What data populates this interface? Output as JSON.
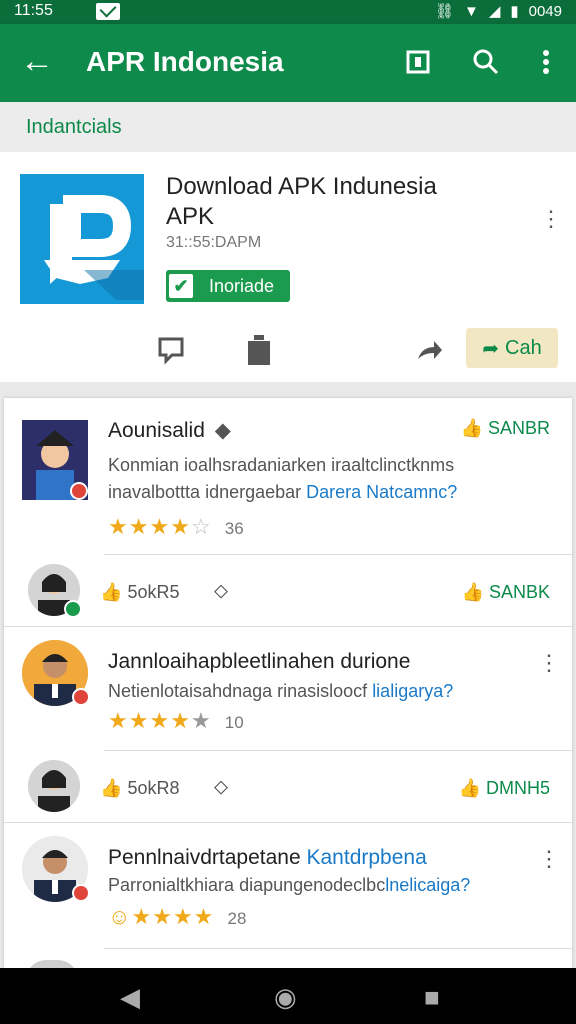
{
  "status": {
    "time": "11:55",
    "right_text": "0049"
  },
  "appbar": {
    "title": "APR Indonesia"
  },
  "section": {
    "label": "Indantcials"
  },
  "app": {
    "title": "Download APK Indunesia APK",
    "subtitle": "31::55:DAPM",
    "installed_label": "Inoriade",
    "cta_label": "Cah"
  },
  "reviews": [
    {
      "name": "Aounisalid",
      "helpful": "SANBR",
      "body_line1": "Konmian ioalhsradaniarken iraaltclinctknms",
      "body_line2": "inavalbottta idnergaebar",
      "body_link": "Darera Natcamnc?",
      "rating": 4,
      "count": "36"
    },
    {
      "likes": "5okR5",
      "helpful": "SANBK"
    },
    {
      "name": "Jannloaihapbleetlinahen durione",
      "body_line1": "Netienlotaisahdnaga rinasisloocf",
      "body_link": "lialigarya?",
      "rating": 4,
      "count": "10"
    },
    {
      "likes": "5okR8",
      "helpful": "DMNH5"
    },
    {
      "name": "Pennlnaivdrtapetane",
      "name_link": "Kantdrpbena",
      "body_line1": "Parronialtkhiara diapungenodeclbc",
      "body_link": "lnelicaiga?",
      "rating": 4,
      "count": "28"
    }
  ],
  "colors": {
    "brand_green": "#0e8a4b",
    "status_green": "#0a6d3a",
    "star": "#f0a91a",
    "link": "#1a7ac8"
  },
  "icons": [
    "back-arrow-icon",
    "bookmark-icon",
    "search-icon",
    "more-vert-icon",
    "share-icon",
    "delete-icon",
    "forward-icon",
    "thumb-up-icon",
    "tag-icon"
  ]
}
